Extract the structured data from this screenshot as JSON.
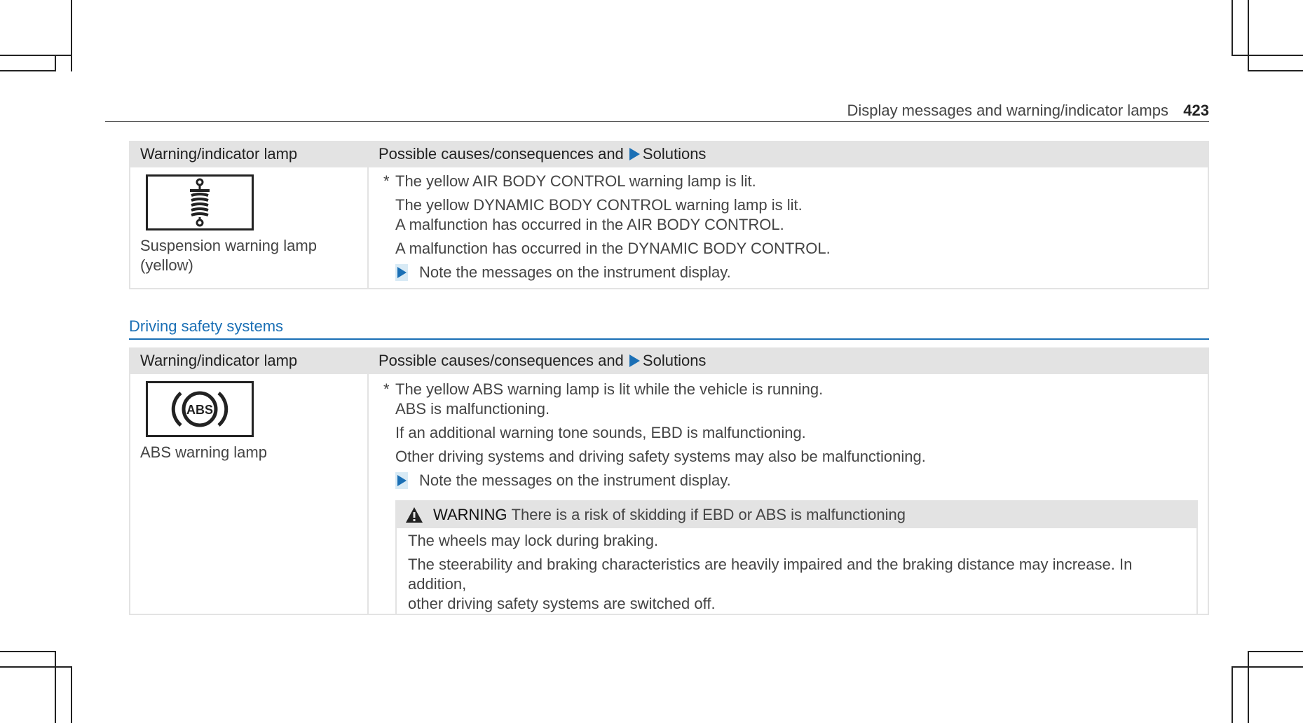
{
  "header": {
    "title": "Display messages and warning/indicator lamps",
    "page": "423"
  },
  "table1": {
    "col1": "Warning/indicator lamp",
    "col2_prefix": "Possible causes/consequences and",
    "col2_suffix": "Solutions",
    "lamp_icon": "suspension-warning-icon",
    "lamp_name_line1": "Suspension warning lamp",
    "lamp_name_line2": "(yellow)",
    "star": "*",
    "cause1": "The yellow AIR BODY CONTROL warning lamp is lit.",
    "cause2": "The yellow DYNAMIC BODY CONTROL warning lamp is lit.",
    "cause3": "A malfunction has occurred in the AIR BODY CONTROL.",
    "cause4": "A malfunction has occurred in the DYNAMIC BODY CONTROL.",
    "action": "Note the messages on the instrument display."
  },
  "section": {
    "title": "Driving safety systems"
  },
  "table2": {
    "col1": "Warning/indicator lamp",
    "col2_prefix": "Possible causes/consequences and",
    "col2_suffix": "Solutions",
    "lamp_icon": "abs-warning-icon",
    "lamp_icon_text": "ABS",
    "lamp_name": "ABS warning lamp",
    "star": "*",
    "cause1": "The yellow ABS warning lamp is lit while the vehicle is running.",
    "cause2": "ABS is malfunctioning.",
    "cause3": "If an additional warning tone sounds, EBD is malfunctioning.",
    "cause4": "Other driving systems and driving safety systems may also be malfunctioning.",
    "action": "Note the messages on the instrument display.",
    "warning": {
      "label": "WARNING",
      "text": "There is a risk of skidding if EBD or ABS is malfunctioning",
      "body1": "The wheels may lock during braking.",
      "body2": "The steerability and braking characteristics are heavily impaired and the braking distance may increase. In addition,",
      "body3": "other driving safety systems are switched off."
    }
  },
  "colors": {
    "accent": "#1a6fb5",
    "header_bg": "#e3e3e3"
  }
}
